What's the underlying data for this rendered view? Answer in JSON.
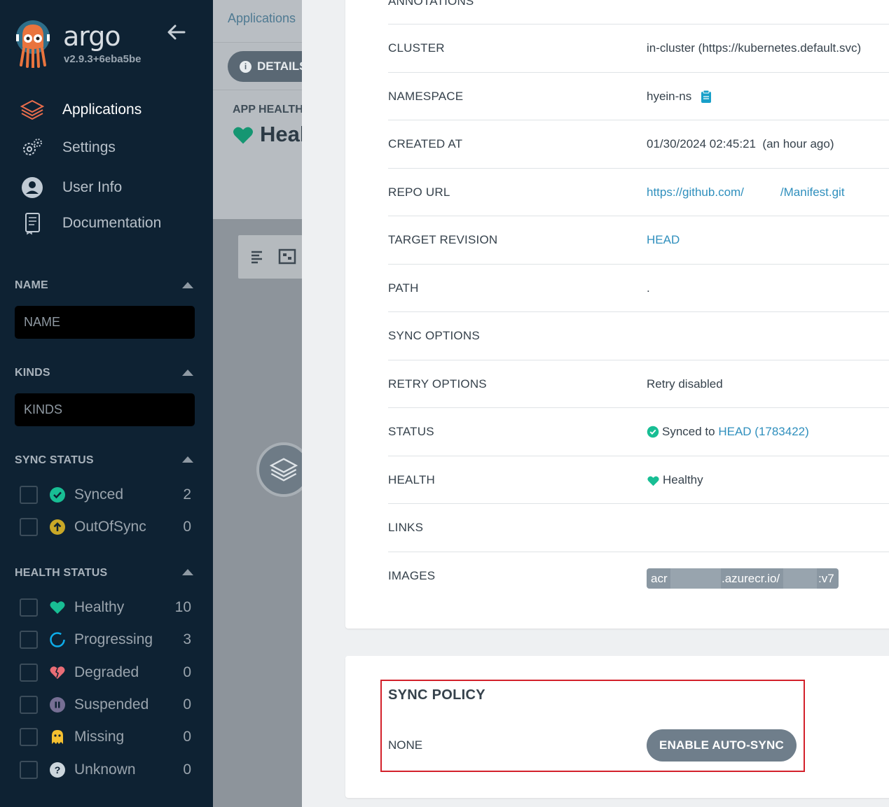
{
  "app": {
    "brand": "argo",
    "version": "v2.9.3+6eba5be"
  },
  "nav": [
    {
      "label": "Applications",
      "icon": "layers-icon"
    },
    {
      "label": "Settings",
      "icon": "gears-icon"
    },
    {
      "label": "User Info",
      "icon": "user-circle-icon"
    },
    {
      "label": "Documentation",
      "icon": "book-icon"
    }
  ],
  "filters": {
    "name": {
      "title": "NAME",
      "placeholder": "NAME"
    },
    "kinds": {
      "title": "KINDS",
      "placeholder": "KINDS"
    },
    "sync_status": {
      "title": "SYNC STATUS",
      "items": [
        {
          "label": "Synced",
          "count": "2",
          "icon": "check-circle-icon",
          "color": "#18be94"
        },
        {
          "label": "OutOfSync",
          "count": "0",
          "icon": "arrow-up-circle-icon",
          "color": "#c9a827"
        }
      ]
    },
    "health_status": {
      "title": "HEALTH STATUS",
      "items": [
        {
          "label": "Healthy",
          "count": "10",
          "icon": "heart-icon",
          "color": "#18be94"
        },
        {
          "label": "Progressing",
          "count": "3",
          "icon": "spinner-icon",
          "color": "#0dadea"
        },
        {
          "label": "Degraded",
          "count": "0",
          "icon": "broken-heart-icon",
          "color": "#e96d76"
        },
        {
          "label": "Suspended",
          "count": "0",
          "icon": "pause-circle-icon",
          "color": "#766f94"
        },
        {
          "label": "Missing",
          "count": "0",
          "icon": "ghost-icon",
          "color": "#f4c030"
        },
        {
          "label": "Unknown",
          "count": "0",
          "icon": "question-circle-icon",
          "color": "#ccd6dd"
        }
      ]
    }
  },
  "middle": {
    "breadcrumb": "Applications",
    "details_label": "DETAILS",
    "app_health_title": "APP HEALTH",
    "app_health_value": "Healthy"
  },
  "details": {
    "annotations_label": "ANNOTATIONS",
    "rows": [
      {
        "label": "CLUSTER",
        "value": "in-cluster (https://kubernetes.default.svc)"
      },
      {
        "label": "NAMESPACE",
        "value": "hyein-ns"
      },
      {
        "label": "CREATED AT",
        "value": "01/30/2024 02:45:21  (an hour ago)"
      },
      {
        "label": "REPO URL",
        "value_start": "https://github.com/",
        "value_end": "/Manifest.git"
      },
      {
        "label": "TARGET REVISION",
        "value": "HEAD"
      },
      {
        "label": "PATH",
        "value": "."
      },
      {
        "label": "SYNC OPTIONS",
        "value": ""
      },
      {
        "label": "RETRY OPTIONS",
        "value": "Retry disabled"
      },
      {
        "label": "STATUS",
        "value_prefix": "Synced to ",
        "value_link": "HEAD (1783422)"
      },
      {
        "label": "HEALTH",
        "value": "Healthy"
      },
      {
        "label": "LINKS",
        "value": ""
      },
      {
        "label": "IMAGES",
        "image_parts": [
          "acr",
          ".azurecr.io/",
          ":v7"
        ]
      }
    ]
  },
  "sync_policy": {
    "title": "SYNC POLICY",
    "value": "NONE",
    "button": "ENABLE AUTO-SYNC"
  }
}
